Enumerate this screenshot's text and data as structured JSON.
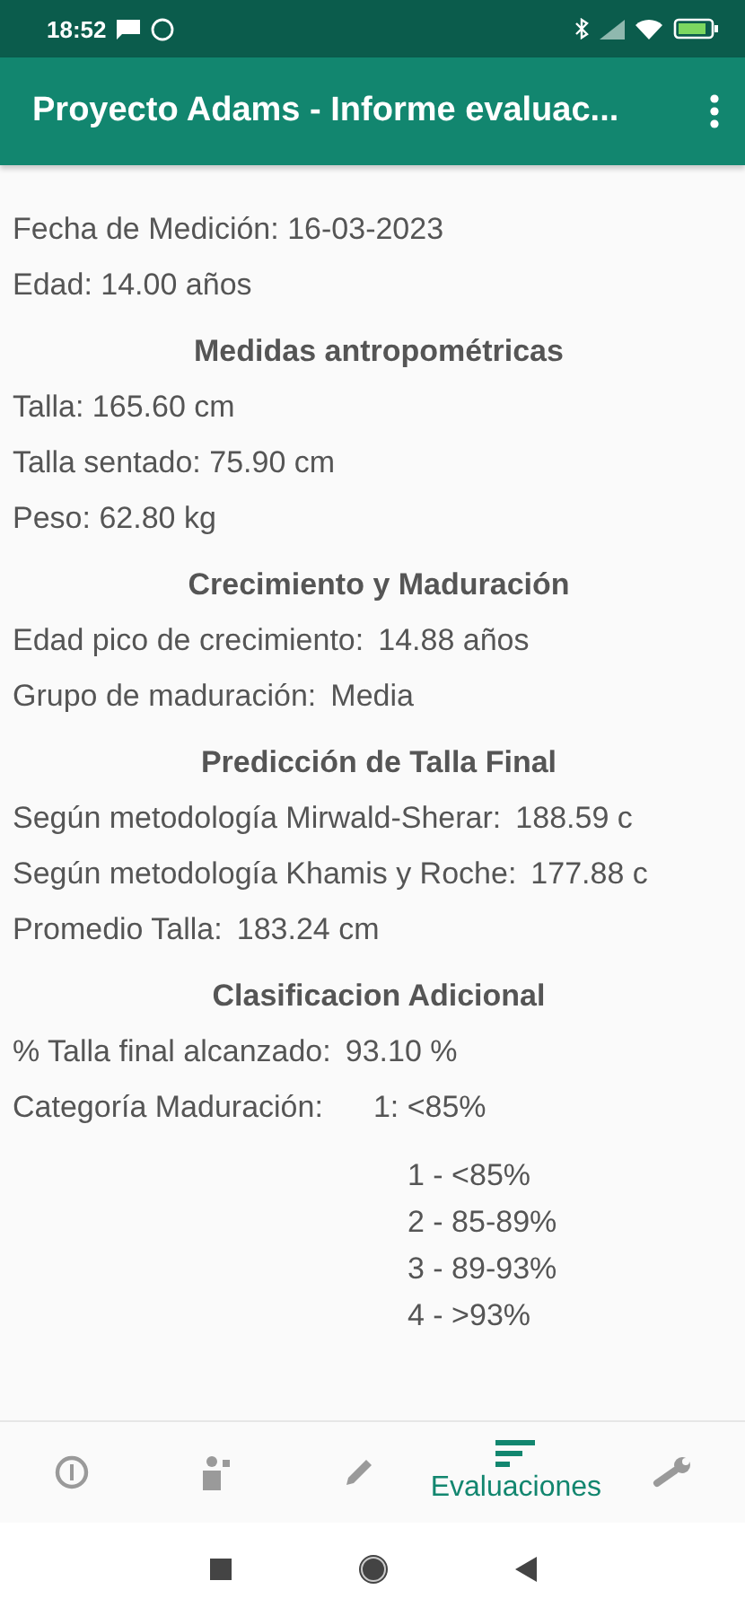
{
  "status_bar": {
    "time": "18:52"
  },
  "app_bar": {
    "title": "Proyecto Adams - Informe evaluac..."
  },
  "sections": [
    {
      "lines": [
        {
          "label": "Fecha de Medición: 16-03-2023"
        },
        {
          "label": "Edad: 14.00 años"
        }
      ]
    },
    {
      "heading": "Medidas antropométricas",
      "lines": [
        {
          "label": "Talla: 165.60 cm"
        },
        {
          "label": "Talla sentado: 75.90 cm"
        },
        {
          "label": "Peso: 62.80 kg"
        }
      ]
    },
    {
      "heading": "Crecimiento y Maduración",
      "lines": [
        {
          "label": "Edad pico de crecimiento:",
          "value": "14.88 años"
        },
        {
          "label": "Grupo de maduración:",
          "value": "Media"
        }
      ]
    },
    {
      "heading": "Predicción de Talla Final",
      "lines": [
        {
          "label": "Según metodología Mirwald-Sherar:",
          "value": "188.59 c"
        },
        {
          "label": "Según metodología Khamis y Roche:",
          "value": "177.88 c"
        },
        {
          "label": "Promedio Talla:",
          "value": "183.24 cm"
        }
      ]
    },
    {
      "heading": "Clasificacion Adicional",
      "lines": [
        {
          "label": "% Talla final alcanzado:",
          "value": "93.10 %"
        },
        {
          "label": "Categoría Maduración:",
          "value": "1: <85%"
        }
      ]
    }
  ],
  "legend": [
    "1 - <85%",
    "2 - 85-89%",
    "3 - 89-93%",
    "4 - >93%"
  ],
  "bottom_nav": [
    {
      "selected": false
    },
    {
      "selected": false
    },
    {
      "selected": false
    },
    {
      "label": "Evaluaciones",
      "selected": true
    },
    {
      "selected": false
    }
  ]
}
